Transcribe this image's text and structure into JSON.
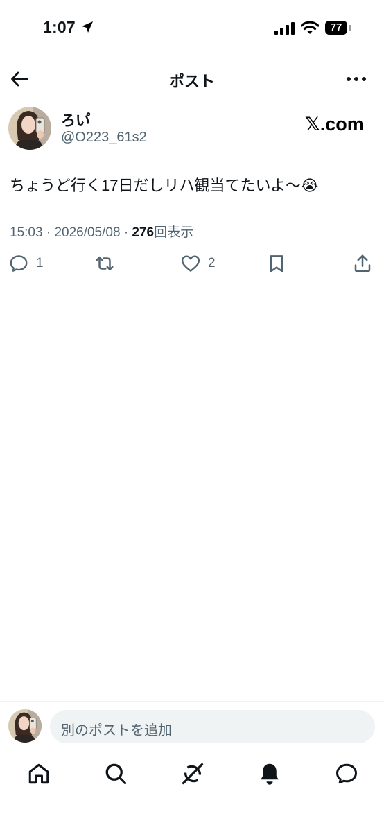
{
  "status_bar": {
    "time": "1:07",
    "battery": "77"
  },
  "header": {
    "title": "ポスト"
  },
  "author": {
    "display_name": "ろい゚",
    "handle": "@O223_61s2"
  },
  "brand": "𝕏.com",
  "post": {
    "text": "ちょうど行く17日だしリハ観当てたいよ〜😭",
    "time": "15:03",
    "date": "2026/05/08",
    "views_count": "276",
    "views_label": "回表示"
  },
  "actions": {
    "reply_count": "1",
    "like_count": "2"
  },
  "reply_box": {
    "placeholder": "別のポストを追加"
  },
  "icons": [
    "signal-icon",
    "wifi-icon",
    "battery-icon",
    "back-arrow-icon",
    "more-icon",
    "reply-icon",
    "repost-icon",
    "like-icon",
    "bookmark-icon",
    "share-icon",
    "home-icon",
    "search-icon",
    "grok-icon",
    "notifications-icon",
    "messages-icon"
  ]
}
